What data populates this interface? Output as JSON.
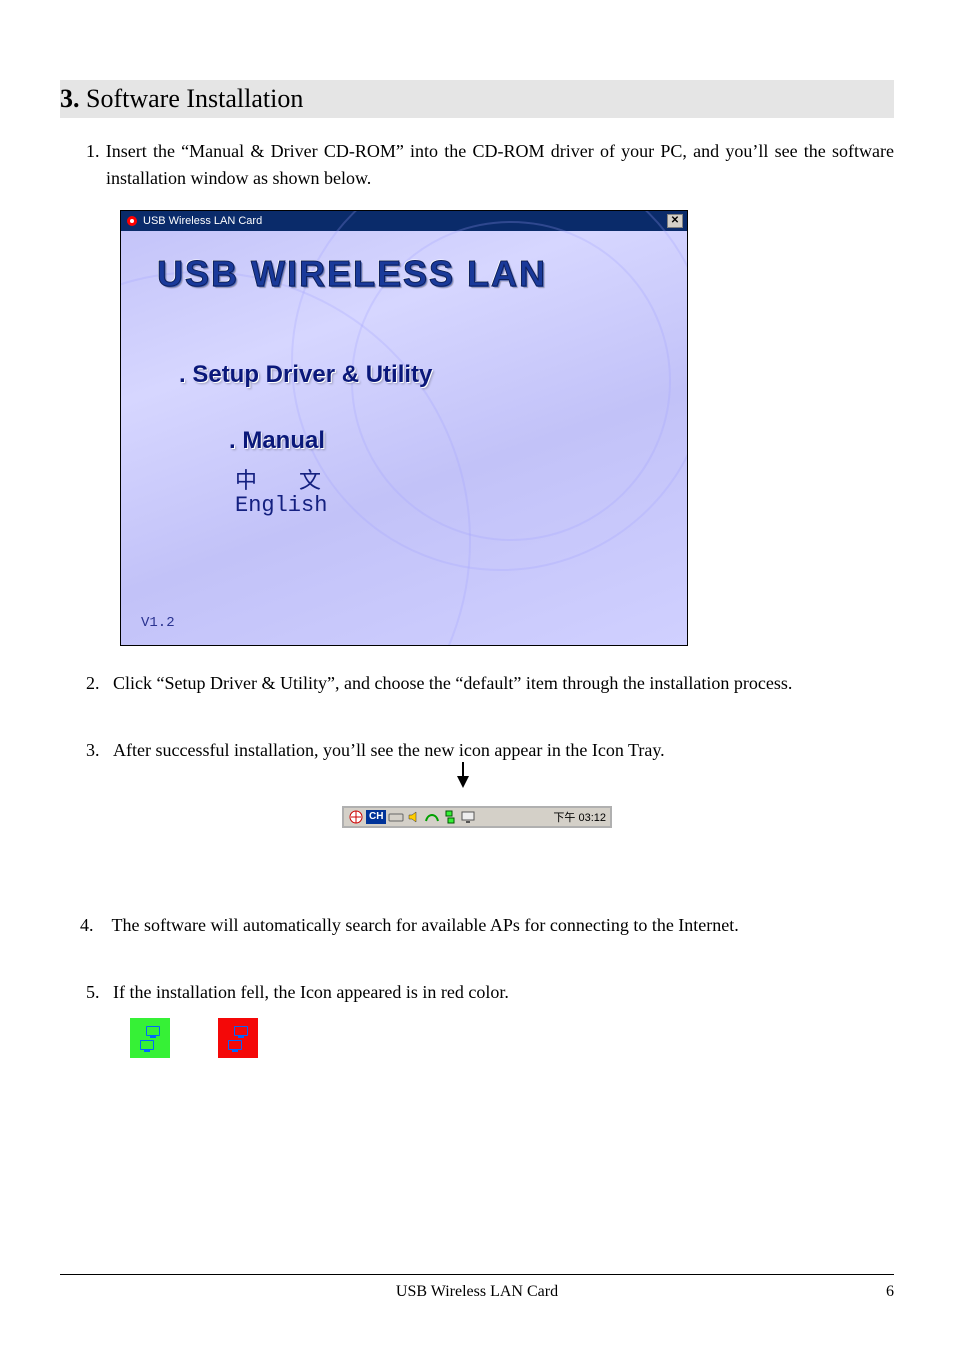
{
  "section": {
    "number": "3.",
    "title": " Software Installation"
  },
  "steps": [
    "Insert the “Manual & Driver CD-ROM” into the CD-ROM driver of your PC, and you’ll see the software installation window as shown below.",
    "Click “Setup Driver & Utility”, and choose the “default” item through the installation process.",
    "After successful installation, you’ll see the new icon appear in the Icon Tray.",
    "The software will automatically search for available APs for connecting to the Internet.",
    "If the installation fell, the Icon appeared is in red color."
  ],
  "installer": {
    "title": "USB Wireless LAN Card",
    "banner": "USB WIRELESS LAN",
    "setup_link": ". Setup Driver & Utility",
    "manual_heading": ". Manual",
    "lang_chinese": "中　文",
    "lang_english": "English",
    "version": "V1.2"
  },
  "tray": {
    "lang": "CH",
    "time": "下午 03:12"
  },
  "footer": {
    "text": "USB Wireless LAN Card",
    "page": "6"
  }
}
